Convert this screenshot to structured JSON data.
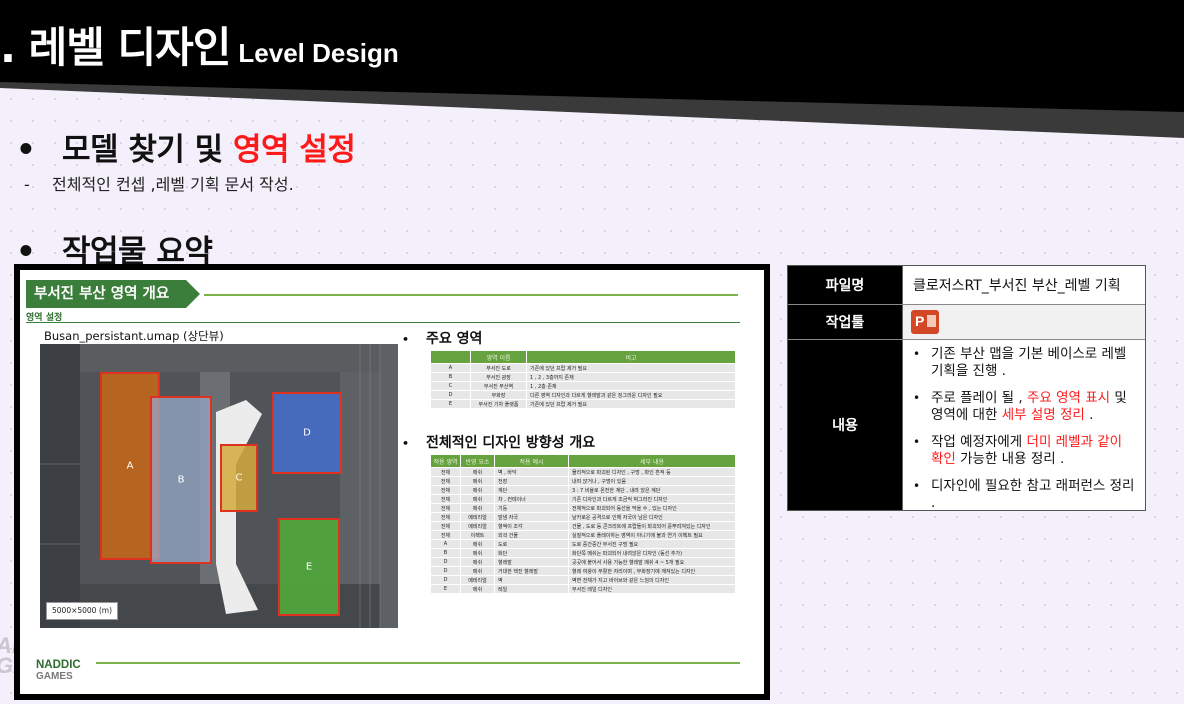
{
  "header": {
    "title_ko": ". 레벨 디자인",
    "title_en": "Level Design"
  },
  "section1": {
    "bullet": "•",
    "title_black": "모델 찾기 및 ",
    "title_red": "영역 설정",
    "dash": "-",
    "subtext": "전체적인 컨셉 ,레벨 기획 문서 작성."
  },
  "section2": {
    "bullet": "•",
    "title": "작업물 요약"
  },
  "slide": {
    "title": "부서진 부산 영역 개요",
    "subtitle": "영역 설정",
    "map_caption": "Busan_persistant.umap (상단뷰)",
    "map_scale": "5000×5000 (m)",
    "areas": [
      "A",
      "B",
      "C",
      "D",
      "E"
    ],
    "main_areas_title": "주요 영역",
    "main_areas_table": {
      "headers": [
        "영역 이름",
        "비고"
      ],
      "rows": [
        [
          "A",
          "부서진 도로",
          "기존에 있던 프랍 제거 필요"
        ],
        [
          "B",
          "부서진 광장",
          "1 , 2 , 3층까지 존재"
        ],
        [
          "C",
          "부서진 부산역",
          "1 , 2층 존재"
        ],
        [
          "D",
          "부화장",
          "다른 영역 디자인과 다르게 혈레발과 같은 징그러운 디자인 필요"
        ],
        [
          "E",
          "부서진 기차 플랫폼",
          "기존에 있던 프랍 제거 필요"
        ]
      ]
    },
    "design_title": "전체적인 디자인 방향성 개요",
    "design_table": {
      "headers": [
        "적용 영역",
        "반영 요소",
        "적용 예시",
        "세부 내용"
      ],
      "rows": [
        [
          "전체",
          "메쉬",
          "벽 , 바닥",
          "물리적으로 파괴된 디자인 , 구멍 , 파인 흔적 등"
        ],
        [
          "전체",
          "메쉬",
          "천장",
          "내려 앉거나 , 구멍이 있음"
        ],
        [
          "전체",
          "메쉬",
          "계단",
          "3 : 7 비율로 온전한 계단 , 내려 앉은 계단"
        ],
        [
          "전체",
          "메쉬",
          "차 , 컨테이너",
          "기존 디자인과 다르게 조금씩 찌그러진 디자인"
        ],
        [
          "전체",
          "메쉬",
          "기둥",
          "전체적으로 파괴되어 동선을 막을 수 , 있는 디자인"
        ],
        [
          "전체",
          "메테리얼",
          "발냄 자국",
          "날카로운 공격으로 인해 자국이 남은 디자인"
        ],
        [
          "전체",
          "메테리얼",
          "혈액이 조각",
          "건물 , 도로 등 콘크리트에 프랍들이 파괴되어 흩뿌려져있는 디자인"
        ],
        [
          "전체",
          "이펙트",
          "외곽 건물",
          "실질적으로 플레이하는 영역이 아니기에 불과 연기 이펙트 필요"
        ],
        [
          "A",
          "메쉬",
          "도로",
          "도로 중간중간 부서진 구멍 필요"
        ],
        [
          "B",
          "메쉬",
          "화단",
          "화단쪽 메쉬는 파괴되어 내려앉은 디자인 (동선 추가)"
        ],
        [
          "D",
          "메쉬",
          "혈레발",
          "곳곳에 붙어서 사용 가능한 혈레발 메쉬 4 ~ 5개 필요"
        ],
        [
          "D",
          "메쉬",
          "거대한 핵진 혈레발",
          "혈레 여왕이 부활한 자리이며 , 부화장기에 깨져있는 디자인"
        ],
        [
          "D",
          "메테리얼",
          "벽",
          "벽면 전체가 지고 바이브와 같은 느낌의 디자인"
        ],
        [
          "E",
          "메쉬",
          "레일",
          "부서진 레일 디자인"
        ]
      ]
    },
    "logo": {
      "line1": "NADDIC",
      "line2": "GAMES"
    },
    "ghost": {
      "line1": "AD",
      "line2": "GA"
    }
  },
  "info": {
    "file_label": "파일명",
    "file_value": "클로저스RT_부서진 부산_레벨 기획",
    "tool_label": "작업툴",
    "tool_icon": "powerpoint-icon",
    "content_label": "내용",
    "items": [
      {
        "a": "기존 부산 맵을 기본 베이스로 레벨 기획을 진행 .",
        "r": "",
        "b": ""
      },
      {
        "a": "주로 플레이 될 , ",
        "r": "주요 영역 표시",
        "b": " 및 영역에 대한 ",
        "r2": "세부 설명 정리",
        "c": " ."
      },
      {
        "a": "작업 예정자에게 ",
        "r": "더미 레벨과 같이 확인",
        "b": " 가능한 내용 정리 ."
      },
      {
        "a": "디자인에 필요한 참고 래퍼런스 정리 .",
        "r": "",
        "b": ""
      }
    ]
  },
  "colors": {
    "accent_red": "#ff1a1a",
    "slide_green": "#3b7d3a",
    "header_black": "#000000"
  }
}
